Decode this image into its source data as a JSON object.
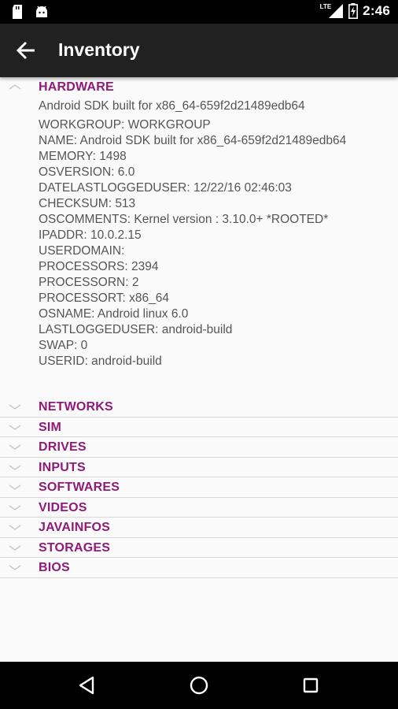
{
  "status_bar": {
    "time": "2:46",
    "network": "LTE",
    "icons": [
      "sd-card-icon",
      "android-icon",
      "signal-icon",
      "battery-charging-icon"
    ]
  },
  "app_bar": {
    "title": "Inventory",
    "back_icon": "arrow-left-icon"
  },
  "hardware": {
    "title": "HARDWARE",
    "summary": "Android SDK built for x86_64-659f2d21489edb64",
    "details": [
      "WORKGROUP: WORKGROUP",
      "NAME: Android SDK built for x86_64-659f2d21489edb64",
      "MEMORY: 1498",
      "OSVERSION: 6.0",
      "DATELASTLOGGEDUSER: 12/22/16 02:46:03",
      "CHECKSUM: 513",
      "OSCOMMENTS: Kernel version : 3.10.0+ *ROOTED*",
      "IPADDR: 10.0.2.15",
      "USERDOMAIN:",
      "PROCESSORS: 2394",
      "PROCESSORN: 2",
      "PROCESSORT: x86_64",
      "OSNAME: Android linux 6.0",
      "LASTLOGGEDUSER: android-build",
      "SWAP: 0",
      "USERID: android-build"
    ]
  },
  "groups": [
    {
      "label": "NETWORKS"
    },
    {
      "label": "SIM"
    },
    {
      "label": "DRIVES"
    },
    {
      "label": "INPUTS"
    },
    {
      "label": "SOFTWARES"
    },
    {
      "label": "VIDEOS"
    },
    {
      "label": "JAVAINFOS"
    },
    {
      "label": "STORAGES"
    },
    {
      "label": "BIOS"
    }
  ],
  "nav_bar": {
    "icons": [
      "back-triangle-icon",
      "home-circle-icon",
      "recents-square-icon"
    ]
  },
  "colors": {
    "accent": "#8e1a7a",
    "app_bar": "#212121",
    "text_detail": "#555555",
    "divider": "#d8d8d8"
  }
}
